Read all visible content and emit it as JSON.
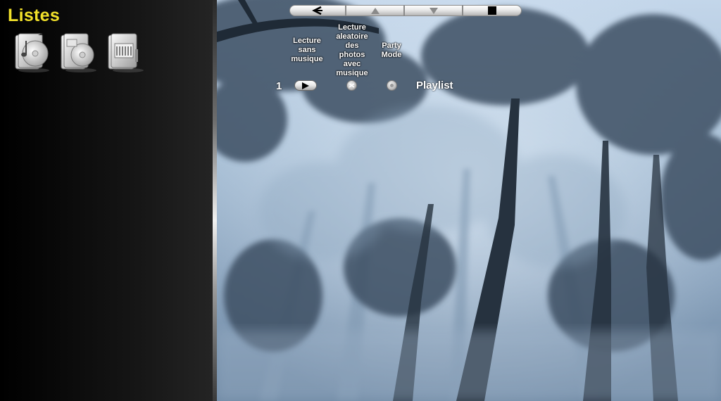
{
  "sidebar": {
    "title": "Listes",
    "icons": [
      {
        "name": "music-list-icon"
      },
      {
        "name": "video-list-icon"
      },
      {
        "name": "photo-list-icon"
      }
    ]
  },
  "transport": {
    "buttons": [
      {
        "icon": "back-arrow-icon"
      },
      {
        "icon": "up-triangle-icon"
      },
      {
        "icon": "down-triangle-icon"
      },
      {
        "icon": "stop-square-icon"
      }
    ]
  },
  "playlist_header": {
    "col1": [
      "Lecture",
      "sans",
      "musique"
    ],
    "col2": [
      "Lecture",
      "aleatoire",
      "des",
      "photos",
      "avec",
      "musique"
    ],
    "col3": [
      "Party",
      "Mode"
    ]
  },
  "playlist_row": {
    "number": "1",
    "name": "Playlist"
  },
  "colors": {
    "title_yellow": "#f2e12a",
    "sidebar_black": "#000000"
  }
}
